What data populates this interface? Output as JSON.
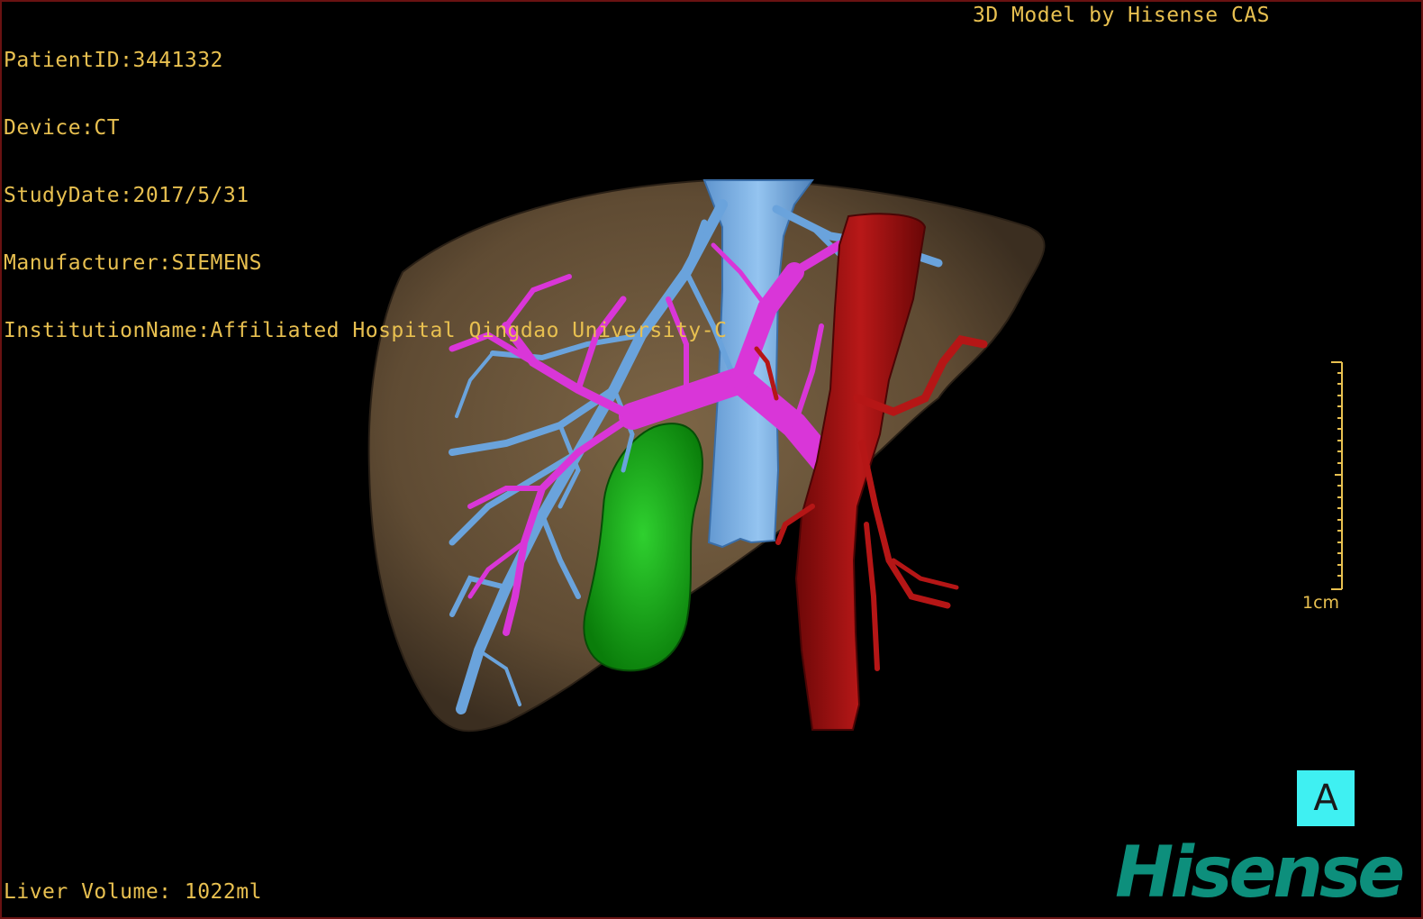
{
  "patient_info": {
    "patient_id": "PatientID:3441332",
    "device": "Device:CT",
    "study_date": "StudyDate:2017/5/31",
    "manufacturer": "Manufacturer:SIEMENS",
    "institution": "InstitutionName:Affiliated Hospital Qingdao University-C"
  },
  "model_credit": "3D Model by Hisense CAS",
  "liver_volume": "Liver Volume: 1022ml",
  "scale": {
    "label": "1cm"
  },
  "orientation_button": {
    "label": "A"
  },
  "brand": {
    "name": "Hisense"
  },
  "colors": {
    "overlay_text": "#e8c050",
    "liver": "#6b553a",
    "hepatic_vein": "#6aa3dc",
    "portal_vein": "#d936d8",
    "artery": "#a01010",
    "gallbladder": "#12a112",
    "orientation_button": "#3ff0f2",
    "brand": "#0d8f7c"
  },
  "scene_objects": [
    "liver-surface",
    "inferior-vena-cava",
    "hepatic-veins",
    "portal-vein",
    "aorta",
    "hepatic-artery",
    "gallbladder"
  ]
}
